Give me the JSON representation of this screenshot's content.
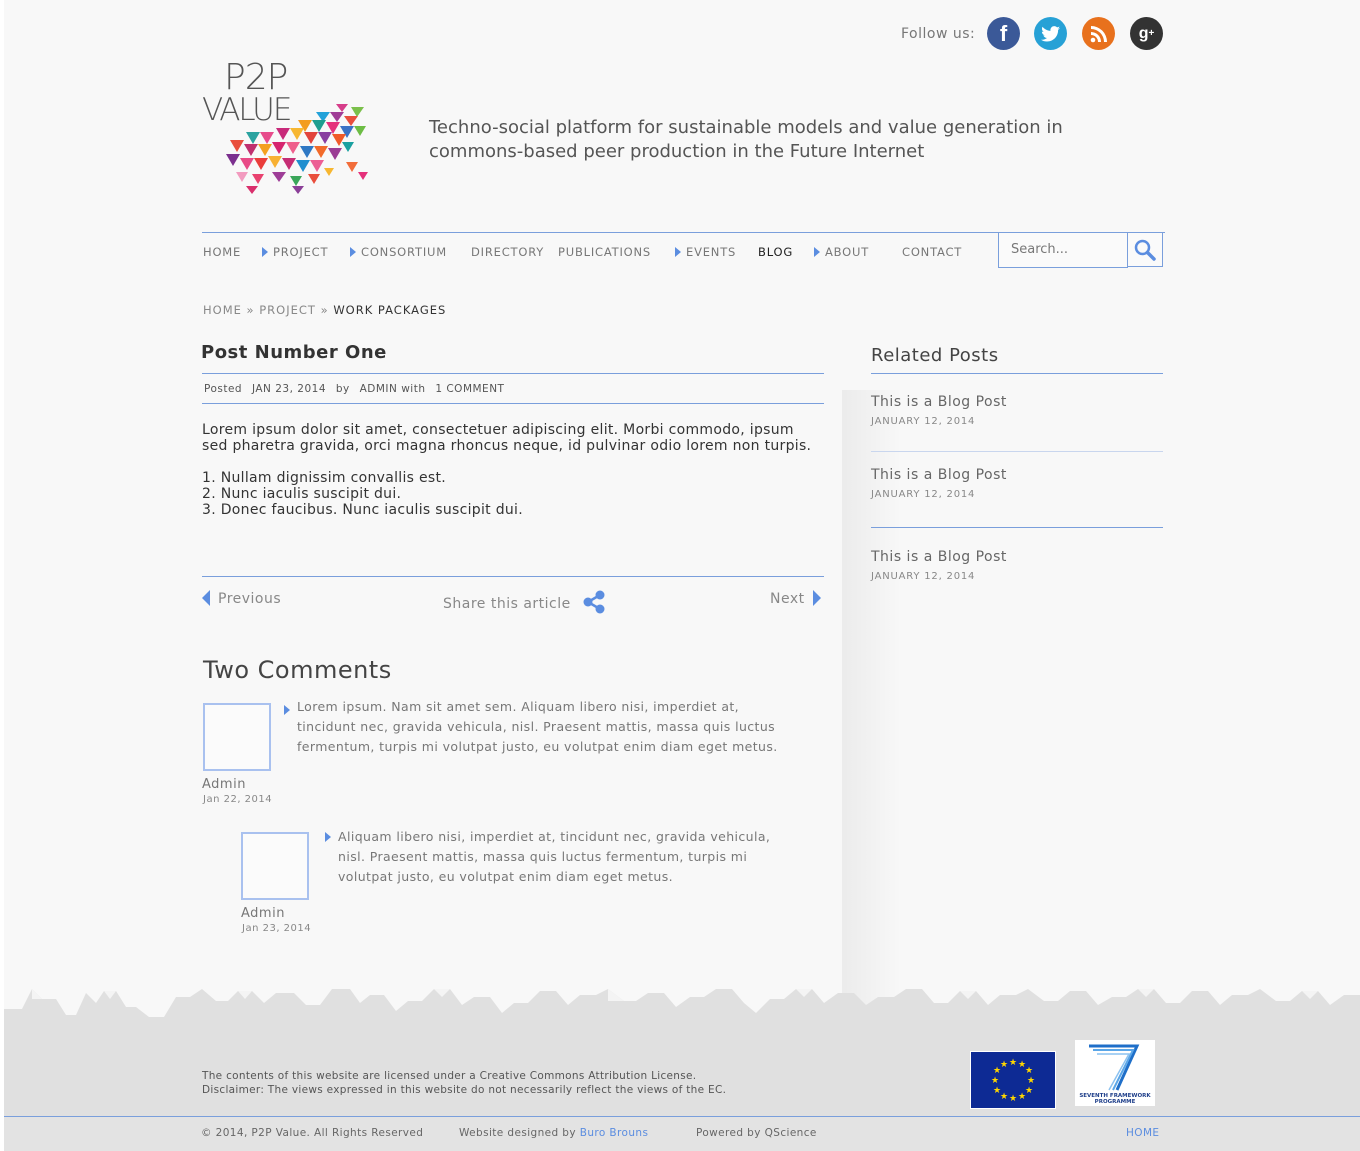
{
  "header": {
    "follow_label": "Follow us:",
    "social": [
      {
        "name": "facebook-icon",
        "glyph": "f",
        "color": "#3b5998"
      },
      {
        "name": "twitter-icon",
        "glyph": "t",
        "color": "#27a1d6"
      },
      {
        "name": "rss-icon",
        "glyph": "rss",
        "color": "#e8711d"
      },
      {
        "name": "google-plus-icon",
        "glyph": "g+",
        "color": "#333333"
      }
    ],
    "logo_line1": "P2P",
    "logo_line2": "VALUE",
    "tagline_line1": "Techno-social platform for sustainable models and value generation in",
    "tagline_line2": "commons-based peer production in the Future Internet"
  },
  "nav": {
    "items": [
      "HOME",
      "PROJECT",
      "CONSORTIUM",
      "DIRECTORY",
      "PUBLICATIONS",
      "EVENTS",
      "BLOG",
      "ABOUT",
      "CONTACT"
    ],
    "search_placeholder": "Search...",
    "search_icon": "magnifier-icon"
  },
  "breadcrumb": {
    "home": "HOME",
    "sep": "»",
    "parent": "PROJECT",
    "current": "WORK PACKAGES"
  },
  "post": {
    "title": "Post Number One",
    "meta_posted": "Posted",
    "meta_date": "JAN 23, 2014",
    "meta_by": "by",
    "meta_author": "ADMIN",
    "meta_with": "with",
    "meta_comments": "1 COMMENT",
    "paragraph": "Lorem ipsum dolor sit amet, consectetuer adipiscing elit. Morbi commodo, ipsum sed pharetra gravida, orci magna rhoncus neque, id pulvinar odio lorem non turpis.",
    "list": [
      "1. Nullam dignissim convallis est.",
      "2. Nunc iaculis suscipit dui.",
      "3. Donec faucibus. Nunc iaculis suscipit dui."
    ],
    "previous": "Previous",
    "share": "Share this article",
    "next": "Next"
  },
  "comments": {
    "title": "Two Comments",
    "items": [
      {
        "text": "Lorem ipsum. Nam sit amet sem. Aliquam libero nisi, imperdiet at, tincidunt nec, gravida vehicula, nisl. Praesent mattis, massa quis luctus fermentum, turpis mi volutpat justo, eu volutpat enim diam eget metus.",
        "author": "Admin",
        "date": "Jan 22, 2014"
      },
      {
        "text": "Aliquam libero nisi, imperdiet at, tincidunt nec, gravida vehicula, nisl. Praesent mattis, massa quis luctus fermentum, turpis mi volutpat justo, eu volutpat enim diam eget metus.",
        "author": "Admin",
        "date": "Jan 23, 2014"
      }
    ]
  },
  "sidebar": {
    "title": "Related Posts",
    "posts": [
      {
        "title": "This is a Blog Post",
        "date": "JANUARY 12, 2014"
      },
      {
        "title": "This is a Blog Post",
        "date": "JANUARY 12, 2014"
      },
      {
        "title": "This is a Blog Post",
        "date": "JANUARY 12, 2014"
      }
    ]
  },
  "footer": {
    "license_line1": "The contents of this website are licensed under a Creative Commons Attribution License.",
    "license_line2": "Disclaimer: The views expressed in this website do not necessarily reflect the views of the EC.",
    "fp7_line1": "SEVENTH FRAMEWORK",
    "fp7_line2": "PROGRAMME",
    "copyright": "© 2014, P2P Value. All Rights Reserved",
    "designed_by_label": "Website designed by",
    "designed_by_link": "Buro Brouns",
    "powered_by": "Powered by QScience",
    "home_link": "HOME"
  },
  "colors": {
    "accent": "#5b8de0",
    "rule": "#7a9fdc",
    "background": "#f8f8f8",
    "footer": "#e3e3e3"
  }
}
